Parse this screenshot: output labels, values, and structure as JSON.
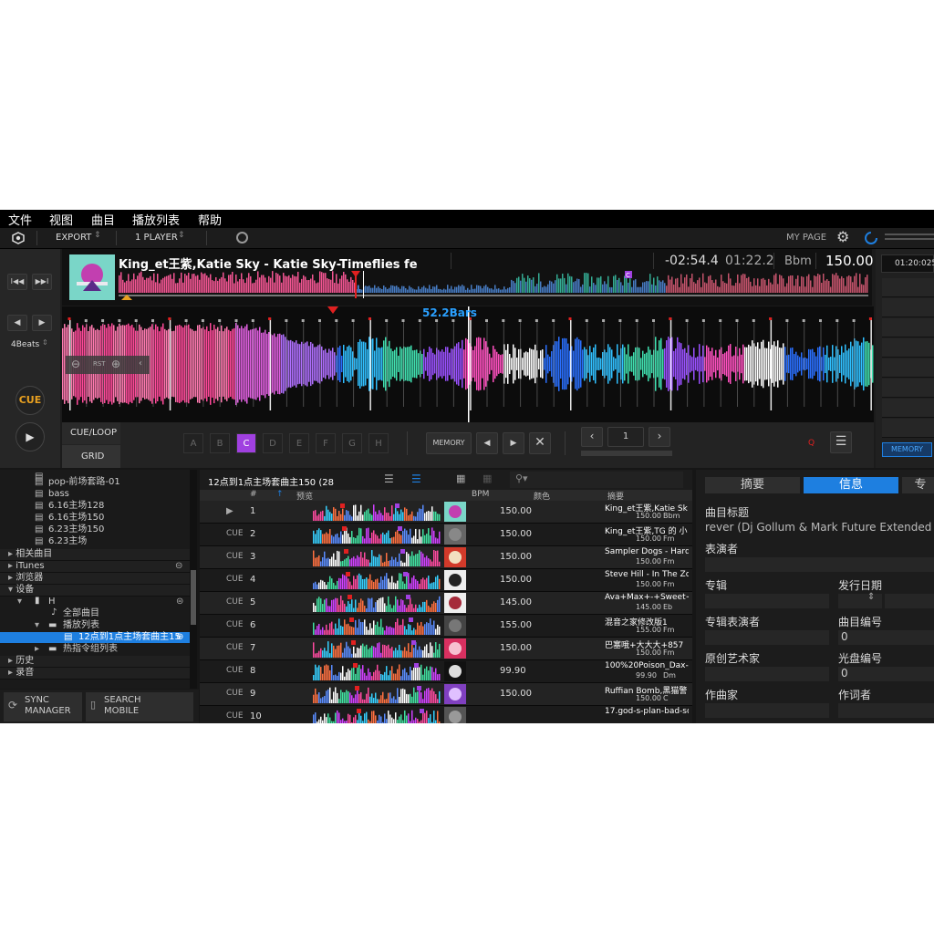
{
  "menu": [
    "文件",
    "视图",
    "曲目",
    "播放列表",
    "帮助"
  ],
  "toolbar": {
    "export": "EXPORT",
    "player": "1 PLAYER",
    "mypage": "MY PAGE"
  },
  "deck": {
    "title": "King_et王紫,Katie Sky - Katie Sky-Timeflies fe",
    "remain": "-02:54.4",
    "elapsed": "01:22.2",
    "key": "Bbm",
    "bpm": "150.00",
    "bars": "52.2Bars",
    "beats": "4Beats",
    "cue": "CUE",
    "rst": "RST",
    "cue_loop": "CUE/LOOP",
    "grid": "GRID",
    "hotcues": [
      "A",
      "B",
      "C",
      "D",
      "E",
      "F",
      "G",
      "H"
    ],
    "memory": "MEMORY",
    "counter": "1",
    "q": "Q",
    "right_time": "01:20:025",
    "right_memory": "MEMORY"
  },
  "tree": {
    "items": [
      "pop-前场套路-01",
      "bass",
      "6.16主场128",
      "6.16主场150",
      "6.23主场150",
      "6.23主场"
    ],
    "related": "相关曲目",
    "itunes": "iTunes",
    "explorer": "浏览器",
    "devices": "设备",
    "device_h": "H",
    "all_tracks": "全部曲目",
    "playlists": "播放列表",
    "selected": "12点到1点主场套曲主15",
    "hotcue_lists": "热指令组列表",
    "history": "历史",
    "recording": "录音"
  },
  "sync": {
    "sync1": "SYNC",
    "sync2": "MANAGER",
    "search1": "SEARCH",
    "search2": "MOBILE"
  },
  "list": {
    "playlist_title": "12点到1点主场套曲主150 (28",
    "cols": {
      "num": "#",
      "preview": "预览",
      "bpm": "BPM",
      "color": "颜色",
      "summary": "摘要"
    },
    "rows": [
      {
        "state": "▶",
        "n": "1",
        "bpm": "150.00",
        "s1": "King_et王紫,Katie Sk",
        "s2": "150.00",
        "k": "Bbm"
      },
      {
        "state": "CUE",
        "n": "2",
        "bpm": "150.00",
        "s1": "King_et王紫,TG 的 小",
        "s2": "150.00",
        "k": "Fm"
      },
      {
        "state": "CUE",
        "n": "3",
        "bpm": "150.00",
        "s1": "Sampler Dogs - Hard",
        "s2": "150.00",
        "k": "Fm"
      },
      {
        "state": "CUE",
        "n": "4",
        "bpm": "150.00",
        "s1": "Steve Hill - In The Zo",
        "s2": "150.00",
        "k": "Fm"
      },
      {
        "state": "CUE",
        "n": "5",
        "bpm": "145.00",
        "s1": "Ava+Max+-+Sweet+8",
        "s2": "145.00",
        "k": "Eb"
      },
      {
        "state": "CUE",
        "n": "6",
        "bpm": "155.00",
        "s1": "混音之家修改版1",
        "s2": "155.00",
        "k": "Fm"
      },
      {
        "state": "CUE",
        "n": "7",
        "bpm": "150.00",
        "s1": "巴塞哦+大大大+857",
        "s2": "150.00",
        "k": "Fm"
      },
      {
        "state": "CUE",
        "n": "8",
        "bpm": "99.90",
        "s1": "100%20Poison_Dax-",
        "s2": "99.90",
        "k": "Dm"
      },
      {
        "state": "CUE",
        "n": "9",
        "bpm": "150.00",
        "s1": "Ruffian Bomb,黑猫警",
        "s2": "150.00",
        "k": "C"
      },
      {
        "state": "CUE",
        "n": "10",
        "bpm": "",
        "s1": "17.god-s-plan-bad-so",
        "s2": "",
        "k": ""
      }
    ]
  },
  "props": {
    "tab1": "摘要",
    "tab2": "信息",
    "tab3": "专",
    "title_label": "曲目标题",
    "title_value": "rever (Dj Gollum & Mark Future Extended Remix",
    "artist": "表演者",
    "album": "专辑",
    "release": "发行日期",
    "album_artist": "专辑表演者",
    "track_no": "曲目编号",
    "track_no_val": "0",
    "orig_artist": "原创艺术家",
    "disc_no": "光盘编号",
    "disc_no_val": "0",
    "composer": "作曲家",
    "lyricist": "作词者"
  },
  "colors": {
    "accent": "#1e7fe0",
    "cue": "#e8a020",
    "hotcue": "#a040e0",
    "red": "#e02020"
  }
}
